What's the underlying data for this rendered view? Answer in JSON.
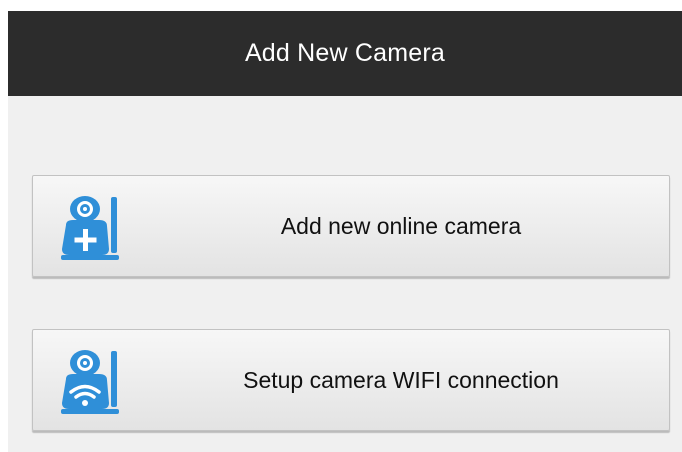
{
  "header": {
    "title": "Add New Camera",
    "background": "#2c2c2c"
  },
  "options": [
    {
      "label": "Add new online camera",
      "icon": "camera-add-icon",
      "icon_color": "#2f8fd8"
    },
    {
      "label": "Setup camera WIFI connection",
      "icon": "camera-wifi-icon",
      "icon_color": "#2f8fd8"
    }
  ]
}
